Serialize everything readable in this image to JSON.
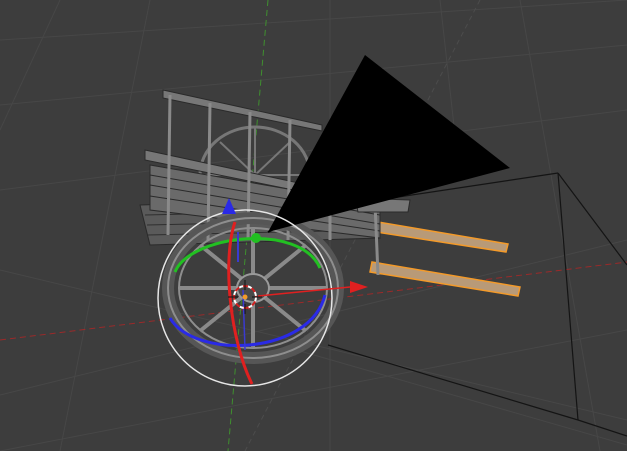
{
  "viewport": {
    "background": "#3d3d3d",
    "grid_color": "#474747",
    "axis_x_color": "#9a2a2a",
    "axis_y_color": "#3f8f2f",
    "selection_color": "#f39a2a"
  },
  "gizmo": {
    "x_color": "#e02020",
    "y_color": "#22c022",
    "z_color": "#2a2ae6",
    "trackball_color": "#e6e6e6"
  },
  "icons": [
    "rotate-gizmo-icon",
    "camera-icon",
    "3d-cursor-icon"
  ]
}
